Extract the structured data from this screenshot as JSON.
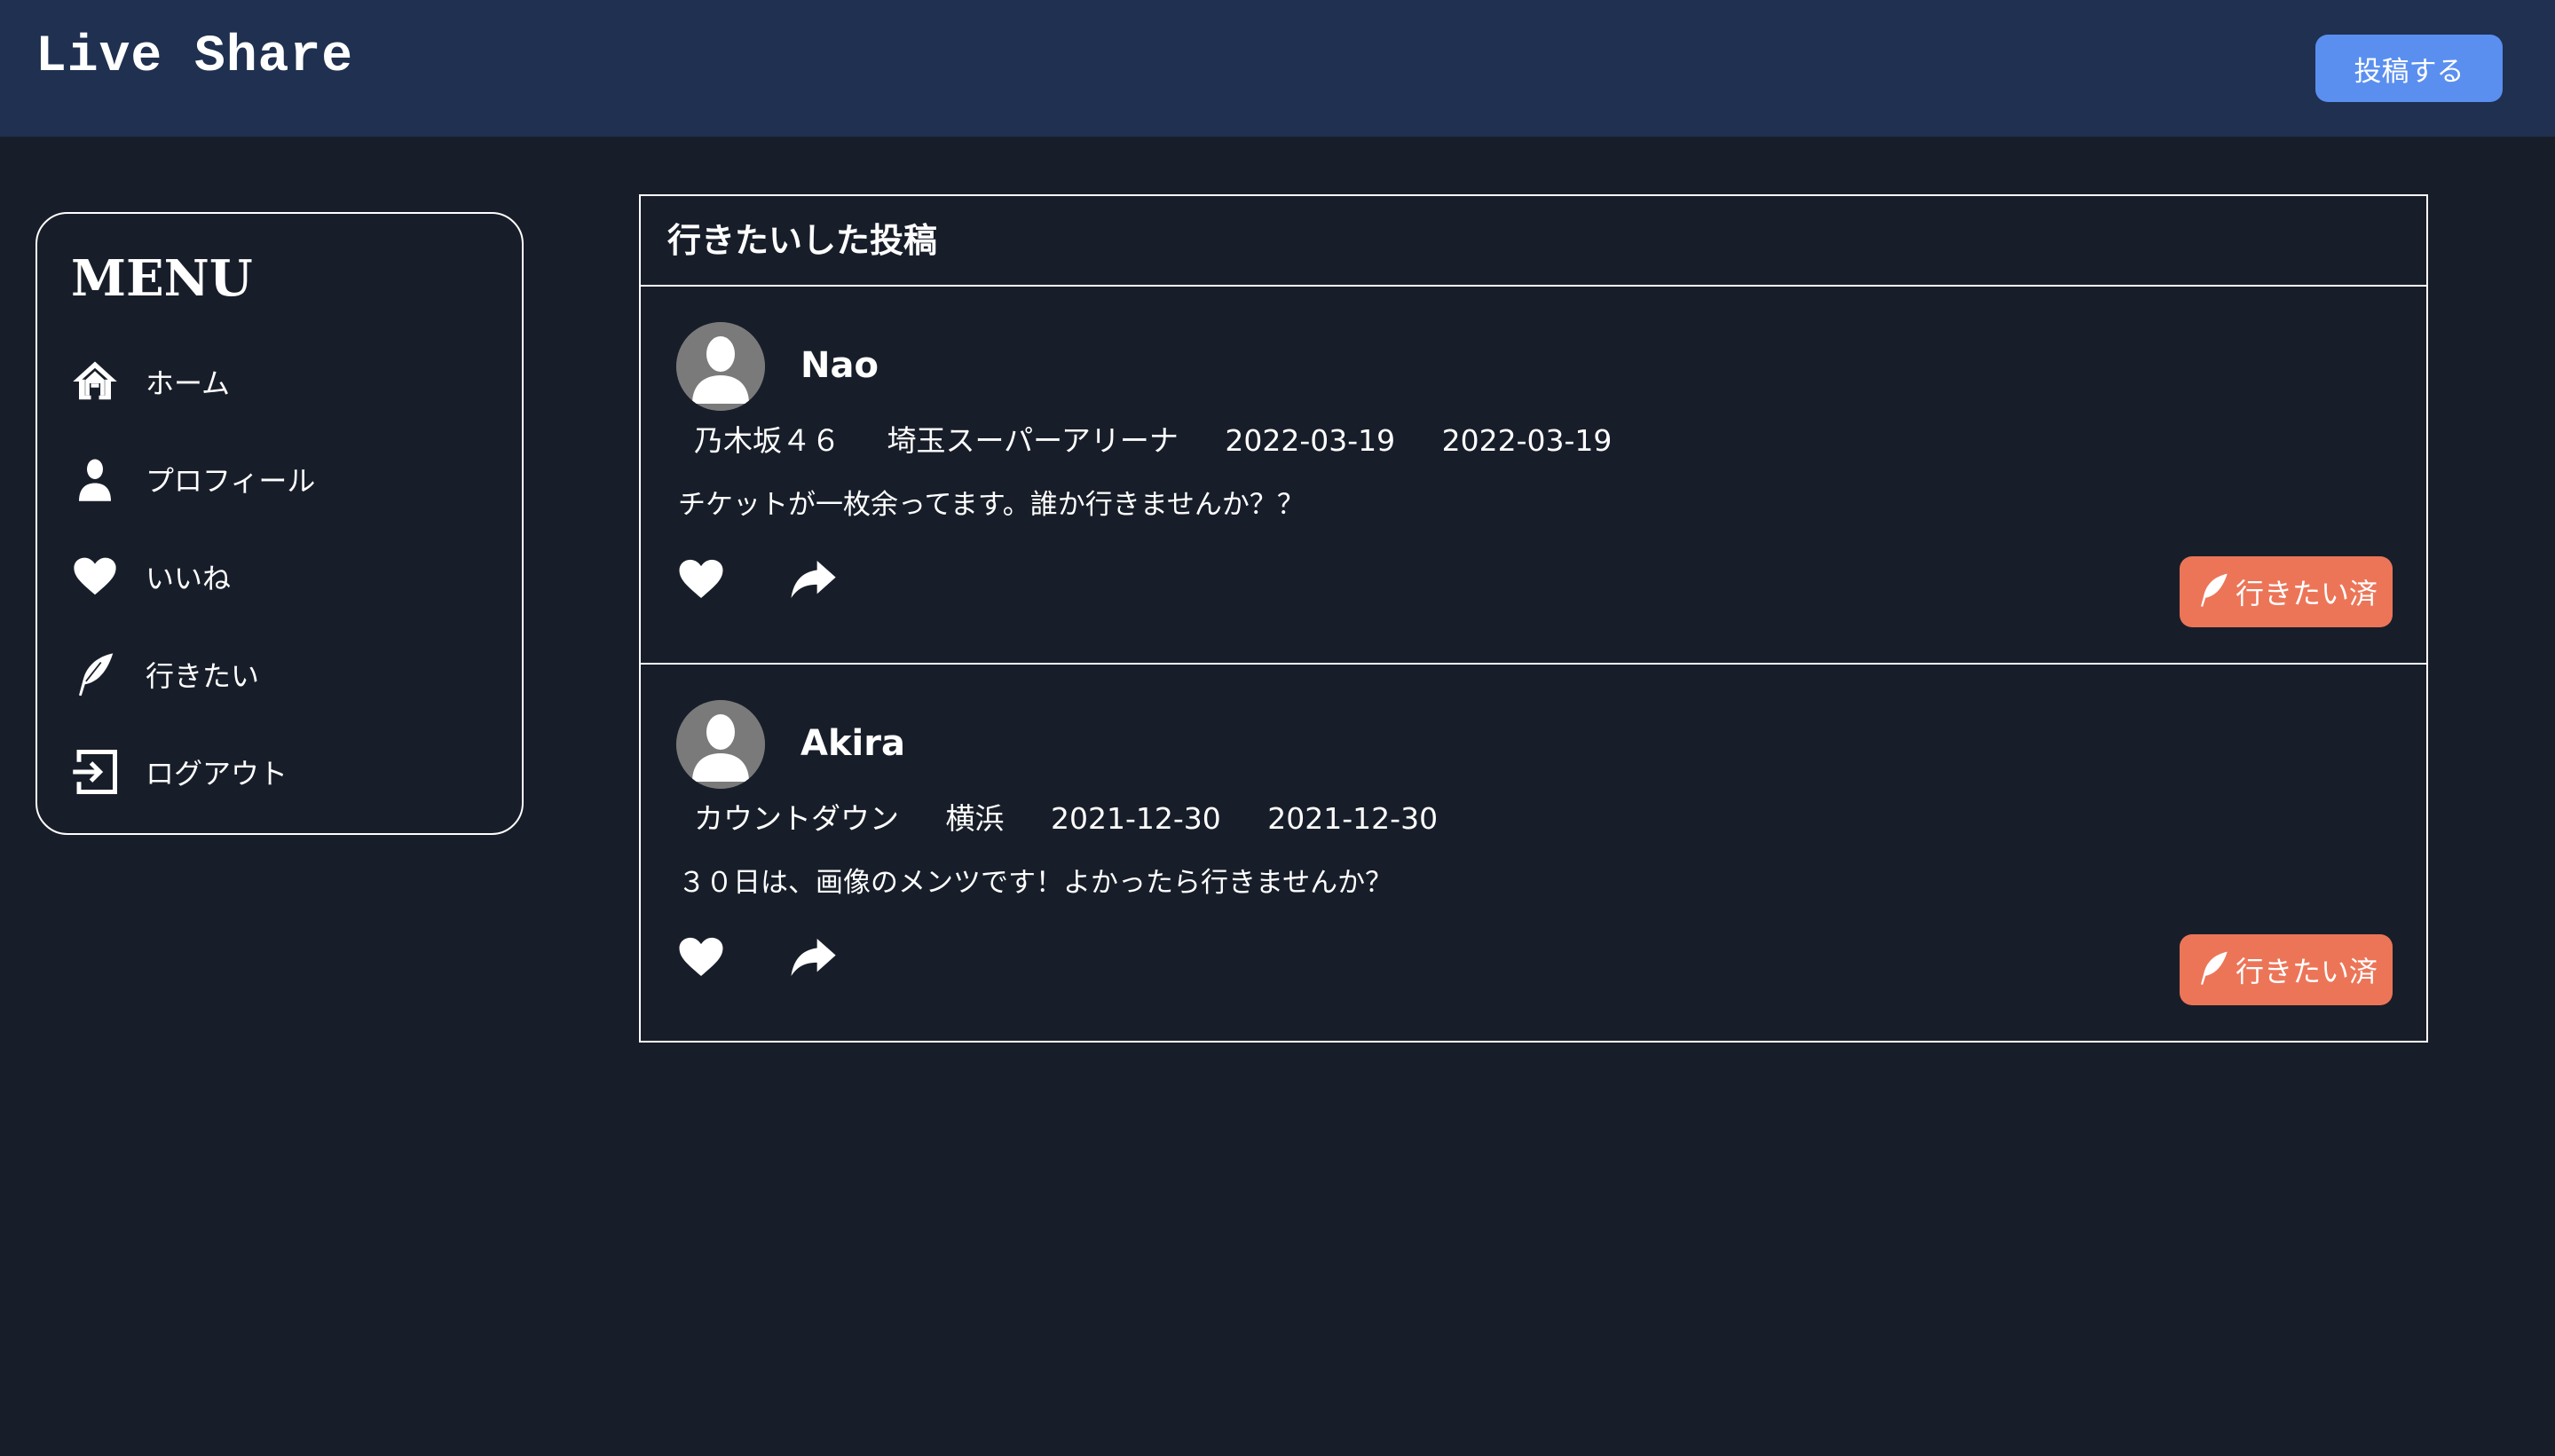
{
  "app": {
    "brand": "Live Share",
    "post_button": "投稿する"
  },
  "menu": {
    "title": "MENU",
    "items": [
      {
        "label": "ホーム",
        "icon": "home-icon"
      },
      {
        "label": "プロフィール",
        "icon": "user-icon"
      },
      {
        "label": "いいね",
        "icon": "heart-icon"
      },
      {
        "label": "行きたい",
        "icon": "feather-icon"
      },
      {
        "label": "ログアウト",
        "icon": "logout-icon"
      }
    ]
  },
  "main": {
    "title": "行きたいした投稿",
    "posts": [
      {
        "user": "Nao",
        "artist": "乃木坂４６",
        "venue": "埼玉スーパーアリーナ",
        "date_start": "2022-03-19",
        "date_end": "2022-03-19",
        "text": "チケットが一枚余ってます。誰か行きませんか？？",
        "going_label": "行きたい済"
      },
      {
        "user": "Akira",
        "artist": "カウントダウン",
        "venue": "横浜",
        "date_start": "2021-12-30",
        "date_end": "2021-12-30",
        "text": "３０日は、画像のメンツです！よかったら行きませんか？",
        "going_label": "行きたい済"
      }
    ]
  },
  "colors": {
    "background": "#181e29",
    "header": "#1f3050",
    "primary_button": "#5a8ff0",
    "going_button": "#ec7558"
  }
}
